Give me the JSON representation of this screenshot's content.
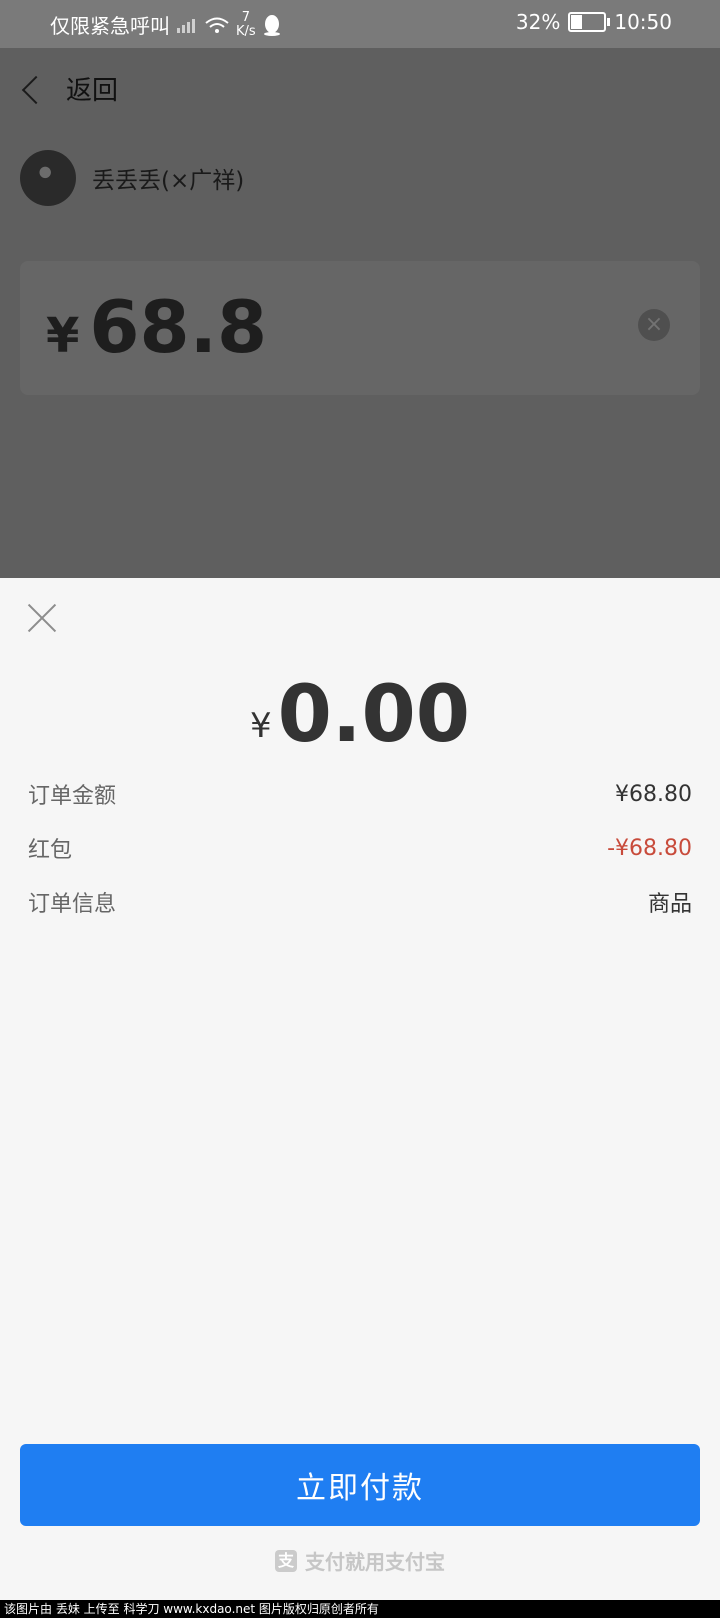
{
  "status_bar": {
    "carrier": "仅限紧急呼叫",
    "speed_value": "7",
    "speed_unit": "K/s",
    "battery_percent": "32%",
    "battery_level": 0.32,
    "time": "10:50",
    "icons": [
      "signal-icon",
      "wifi-icon",
      "qq-icon",
      "battery-icon"
    ]
  },
  "nav": {
    "back_label": "返回"
  },
  "merchant": {
    "name": "丢丢丢(×广祥)"
  },
  "input_amount": {
    "currency": "¥",
    "value": "68.8"
  },
  "sheet": {
    "pay_currency": "¥",
    "pay_amount": "0.00",
    "rows": [
      {
        "label": "订单金额",
        "value": "¥68.80"
      },
      {
        "label": "红包",
        "value": "-¥68.80"
      },
      {
        "label": "订单信息",
        "value": "商品"
      }
    ],
    "pay_button_label": "立即付款",
    "brand_text": "支付就用支付宝"
  },
  "watermark": "该图片由 丢妹 上传至 科学刀 www.kxdao.net 图片版权归原创者所有",
  "colors": {
    "accent": "#1f7ef2",
    "discount": "#c84b3b"
  }
}
